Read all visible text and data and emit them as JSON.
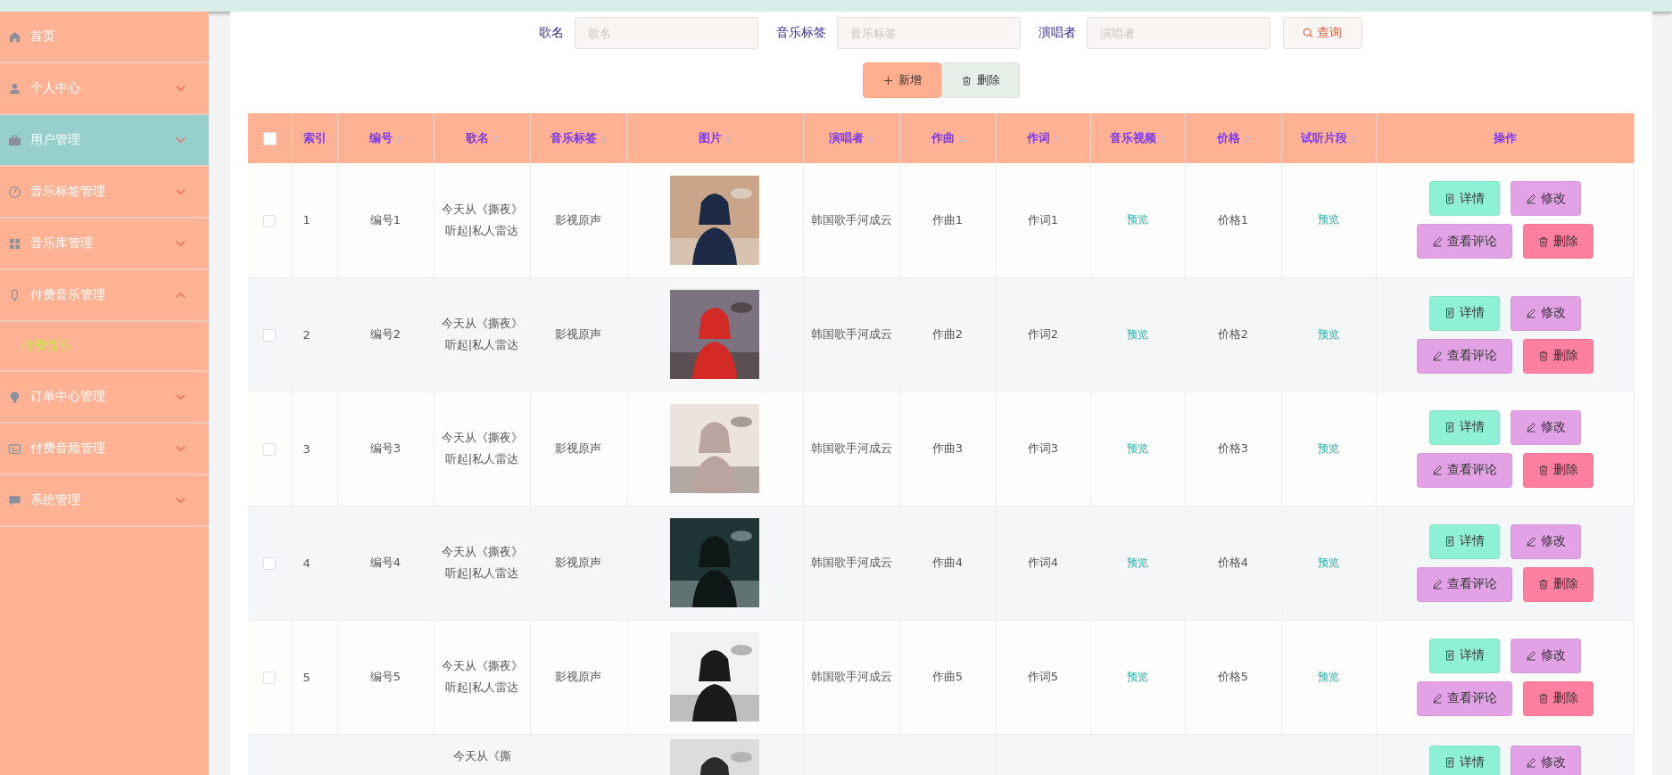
{
  "sidebar": {
    "items": [
      {
        "label": "首页",
        "selected": false
      },
      {
        "label": "个人中心",
        "selected": false,
        "expanded": false
      },
      {
        "label": "用户管理",
        "selected": true,
        "expanded": false
      },
      {
        "label": "音乐标签管理",
        "selected": false,
        "expanded": false
      },
      {
        "label": "音乐库管理",
        "selected": false,
        "expanded": false
      },
      {
        "label": "付费音乐管理",
        "selected": false,
        "expanded": true,
        "children": [
          {
            "label": "付费音乐"
          }
        ]
      },
      {
        "label": "订单中心管理",
        "selected": false,
        "expanded": false
      },
      {
        "label": "付费音频管理",
        "selected": false,
        "expanded": false
      },
      {
        "label": "系统管理",
        "selected": false,
        "expanded": false
      }
    ]
  },
  "search": {
    "fields": [
      {
        "label": "歌名",
        "placeholder": "歌名"
      },
      {
        "label": "音乐标签",
        "placeholder": "音乐标签"
      },
      {
        "label": "演唱者",
        "placeholder": "演唱者"
      }
    ],
    "button": "查询"
  },
  "toolbar": {
    "add": "新增",
    "delete": "删除"
  },
  "table": {
    "select_all": false,
    "columns": [
      {
        "label": "索引",
        "sortable": false
      },
      {
        "label": "编号",
        "sortable": true
      },
      {
        "label": "歌名",
        "sortable": true
      },
      {
        "label": "音乐标签",
        "sortable": true
      },
      {
        "label": "图片",
        "sortable": true
      },
      {
        "label": "演唱者",
        "sortable": true
      },
      {
        "label": "作曲",
        "sortable": true
      },
      {
        "label": "作词",
        "sortable": true
      },
      {
        "label": "音乐视频",
        "sortable": true
      },
      {
        "label": "价格",
        "sortable": true
      },
      {
        "label": "试听片段",
        "sortable": true
      },
      {
        "label": "操作",
        "sortable": false
      }
    ],
    "rows": [
      {
        "checked": false,
        "index": "1",
        "code": "编号1",
        "title": "今天从《撕夜》听起|私人雷达",
        "tag": "影视原声",
        "singer": "韩国歌手河成云",
        "composer": "作曲1",
        "lyricist": "作词1",
        "video": "预览",
        "price": "价格1",
        "clip": "预览",
        "actions": [
          "详情",
          "修改",
          "查看评论",
          "删除"
        ]
      },
      {
        "checked": false,
        "index": "2",
        "code": "编号2",
        "title": "今天从《撕夜》听起|私人雷达",
        "tag": "影视原声",
        "singer": "韩国歌手河成云",
        "composer": "作曲2",
        "lyricist": "作词2",
        "video": "预览",
        "price": "价格2",
        "clip": "预览",
        "actions": [
          "详情",
          "修改",
          "查看评论",
          "删除"
        ]
      },
      {
        "checked": false,
        "index": "3",
        "code": "编号3",
        "title": "今天从《撕夜》听起|私人雷达",
        "tag": "影视原声",
        "singer": "韩国歌手河成云",
        "composer": "作曲3",
        "lyricist": "作词3",
        "video": "预览",
        "price": "价格3",
        "clip": "预览",
        "actions": [
          "详情",
          "修改",
          "查看评论",
          "删除"
        ]
      },
      {
        "checked": false,
        "index": "4",
        "code": "编号4",
        "title": "今天从《撕夜》听起|私人雷达",
        "tag": "影视原声",
        "singer": "韩国歌手河成云",
        "composer": "作曲4",
        "lyricist": "作词4",
        "video": "预览",
        "price": "价格4",
        "clip": "预览",
        "actions": [
          "详情",
          "修改",
          "查看评论",
          "删除"
        ]
      },
      {
        "checked": false,
        "index": "5",
        "code": "编号5",
        "title": "今天从《撕夜》听起|私人雷达",
        "tag": "影视原声",
        "singer": "韩国歌手河成云",
        "composer": "作曲5",
        "lyricist": "作词5",
        "video": "预览",
        "price": "价格5",
        "clip": "预览",
        "actions": [
          "详情",
          "修改",
          "查看评论",
          "删除"
        ]
      },
      {
        "title": "今天从《撕",
        "actions": [
          "详情",
          "修改"
        ]
      }
    ]
  }
}
